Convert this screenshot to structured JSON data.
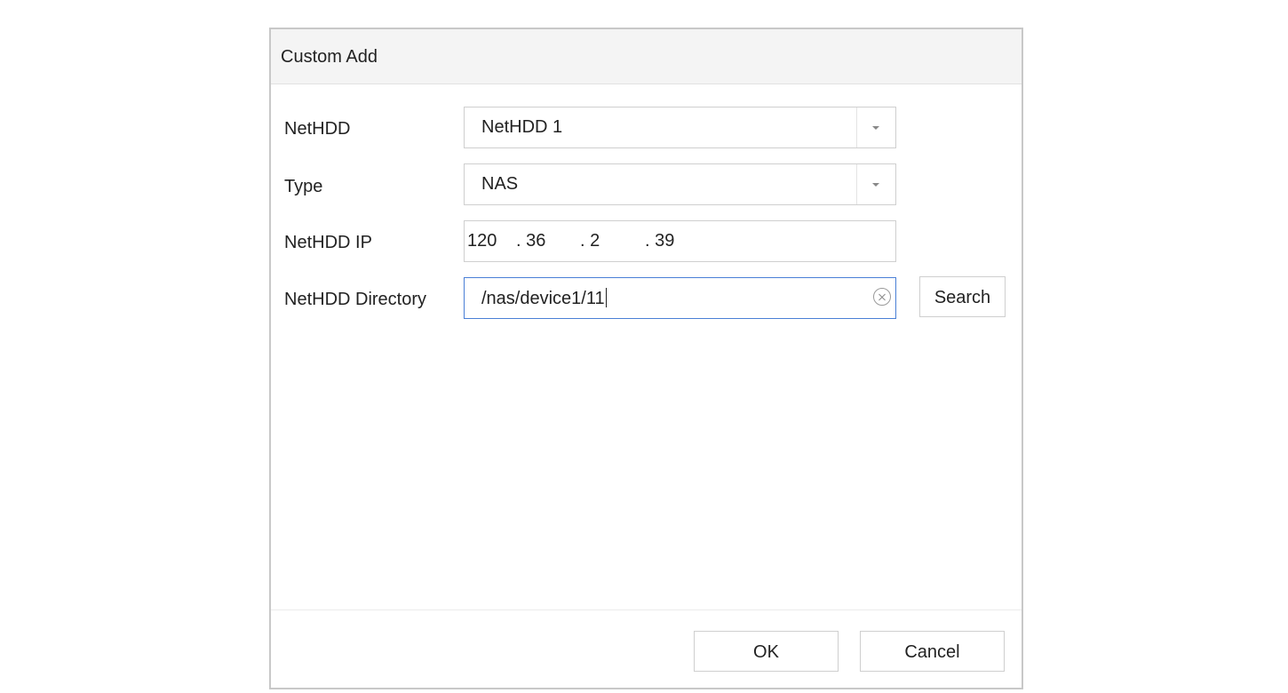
{
  "dialog": {
    "title": "Custom Add"
  },
  "form": {
    "nethdd": {
      "label": "NetHDD",
      "value": "NetHDD 1"
    },
    "type": {
      "label": "Type",
      "value": "NAS"
    },
    "ip": {
      "label": "NetHDD IP",
      "segments": [
        "120",
        ". 36",
        ". 2",
        ". 39"
      ]
    },
    "directory": {
      "label": "NetHDD Directory",
      "value": "/nas/device1/11"
    },
    "search_label": "Search"
  },
  "footer": {
    "ok_label": "OK",
    "cancel_label": "Cancel"
  },
  "colors": {
    "focus_border": "#4a7fd6",
    "header_bg": "#f4f4f4"
  },
  "icons": {
    "dropdown": "chevron-down-icon",
    "clear": "clear-icon"
  }
}
